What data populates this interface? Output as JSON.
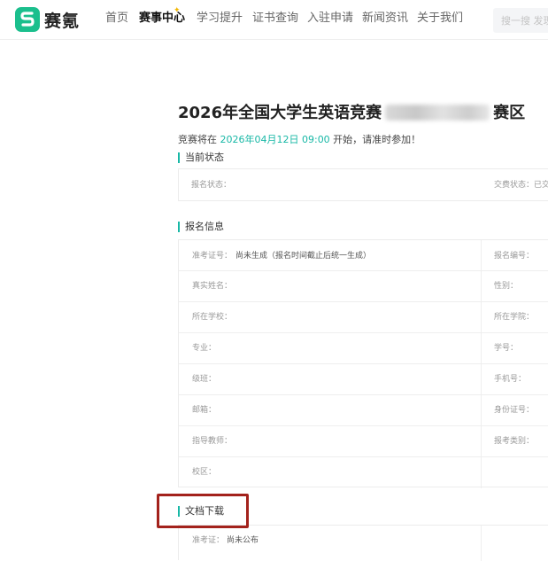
{
  "nav": {
    "logo_text": "赛氪",
    "items": [
      "首页",
      "赛事中心",
      "学习提升",
      "证书查询",
      "入驻申请",
      "新闻资讯",
      "关于我们"
    ],
    "search_placeholder": "搜一搜 发现"
  },
  "page": {
    "title_prefix": "2026年全国大学生英语竞赛",
    "title_suffix": "赛区",
    "start_prefix": "竞赛将在 ",
    "start_time": "2026年04月12日 09:00",
    "start_suffix": " 开始，请准时参加！"
  },
  "status": {
    "heading": "当前状态",
    "reg_label": "报名状态：",
    "pay_label": "交费状态：已交"
  },
  "registration": {
    "heading": "报名信息",
    "left": [
      {
        "label": "准考证号：",
        "value": "尚未生成（报名时间截止后统一生成）"
      },
      {
        "label": "真实姓名：",
        "value": ""
      },
      {
        "label": "所在学校：",
        "value": ""
      },
      {
        "label": "专业：",
        "value": ""
      },
      {
        "label": "级班：",
        "value": ""
      },
      {
        "label": "邮箱：",
        "value": ""
      },
      {
        "label": "指导教师：",
        "value": ""
      },
      {
        "label": "校区：",
        "value": ""
      }
    ],
    "right": [
      {
        "label": "报名编号："
      },
      {
        "label": "性别："
      },
      {
        "label": "所在学院："
      },
      {
        "label": "学号："
      },
      {
        "label": "手机号："
      },
      {
        "label": "身份证号："
      },
      {
        "label": "报考类别："
      },
      {
        "label": ""
      }
    ]
  },
  "documents": {
    "heading": "文档下载",
    "ticket_label": "准考证：",
    "ticket_value": "尚未公布"
  }
}
